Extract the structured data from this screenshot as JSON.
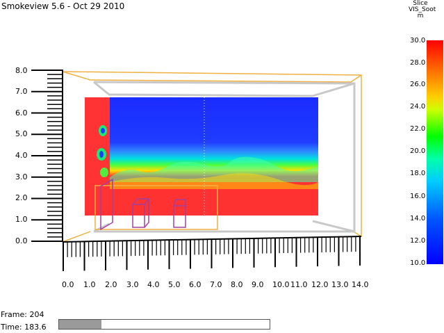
{
  "app": {
    "title": "Smokeview 5.6 - Oct 29 2010"
  },
  "colorbar": {
    "header": [
      "Slice",
      "VIS_Soot",
      "m"
    ],
    "labels": [
      "30.0",
      "28.0",
      "26.0",
      "24.0",
      "22.0",
      "20.0",
      "18.0",
      "16.0",
      "14.0",
      "12.0",
      "10.0"
    ]
  },
  "y_axis": {
    "labels": [
      "8.0",
      "7.0",
      "6.0",
      "5.0",
      "4.0",
      "3.0",
      "2.0",
      "1.0",
      "0.0"
    ]
  },
  "x_axis": {
    "labels": [
      "0.0",
      "1.0",
      "2.0",
      "3.0",
      "4.0",
      "5.0",
      "6.0",
      "7.0",
      "8.0",
      "9.0",
      "10.0",
      "11.0",
      "12.0",
      "13.0",
      "14.0"
    ]
  },
  "status": {
    "frame_label": "Frame: 204",
    "time_label": "Time: 183.6",
    "progress": 0.2
  }
}
